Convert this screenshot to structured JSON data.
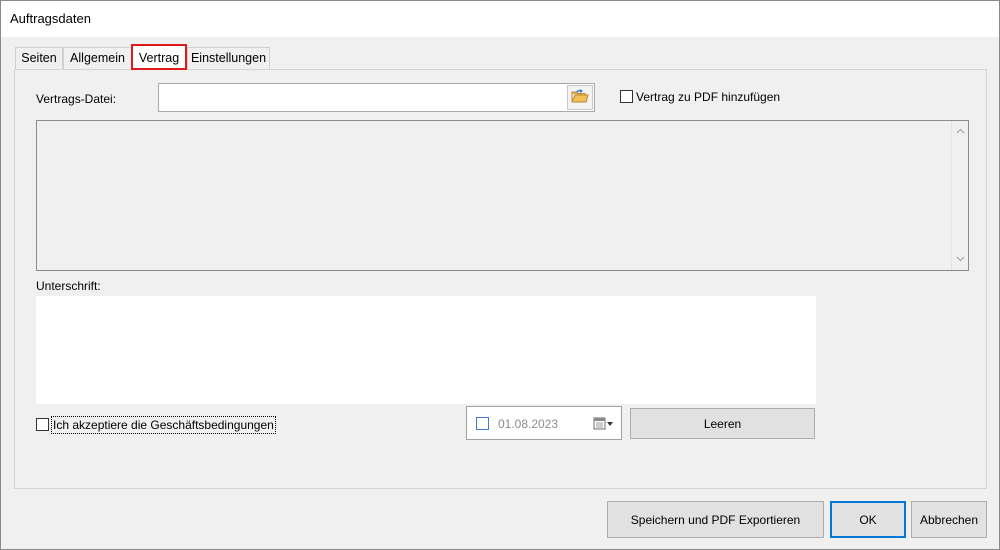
{
  "window": {
    "title": "Auftragsdaten"
  },
  "tabs": [
    {
      "label": "Seiten"
    },
    {
      "label": "Allgemein"
    },
    {
      "label": "Vertrag"
    },
    {
      "label": "Einstellungen"
    }
  ],
  "contract": {
    "file_label": "Vertrags-Datei:",
    "file_value": "",
    "add_to_pdf_label": "Vertrag zu PDF hinzufügen",
    "add_to_pdf_checked": false
  },
  "signature": {
    "label": "Unterschrift:",
    "accept_terms_label": "Ich akzeptiere die Geschäftsbedingungen",
    "accept_terms_checked": false,
    "date_value": "01.08.2023",
    "clear_button": "Leeren"
  },
  "footer": {
    "save_export_button": "Speichern und PDF Exportieren",
    "ok_button": "OK",
    "cancel_button": "Abbrechen"
  },
  "colors": {
    "active_tab_highlight": "#e01a1a",
    "primary_button_border": "#0078d7",
    "dialog_background": "#f0f0f0"
  }
}
